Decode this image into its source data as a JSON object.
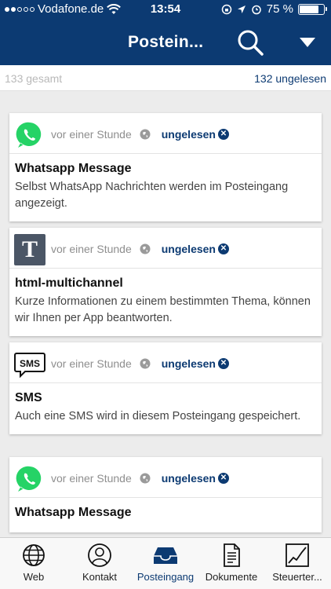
{
  "status": {
    "carrier": "Vodafone.de",
    "time": "13:54",
    "battery": "75 %"
  },
  "header": {
    "title": "Postein...",
    "search_icon": "search-icon",
    "dropdown_icon": "triangle-down-icon"
  },
  "counts": {
    "total": "133 gesamt",
    "unread": "132 ungelesen"
  },
  "messages": [
    {
      "icon": "whatsapp-icon",
      "time": "vor einer Stunde",
      "badge": "ungelesen",
      "title": "Whatsapp Message",
      "text": "Selbst WhatsApp Nachrichten werden im Posteingang angezeigt."
    },
    {
      "icon": "text-t-icon",
      "icon_letter": "T",
      "time": "vor einer Stunde",
      "badge": "ungelesen",
      "title": "html-multichannel",
      "text": "Kurze Informationen zu einem bestimmten Thema, können wir Ihnen per App beantworten."
    },
    {
      "icon": "sms-icon",
      "icon_text": "SMS",
      "time": "vor einer Stunde",
      "badge": "ungelesen",
      "title": "SMS",
      "text": "Auch eine SMS wird in diesem Posteingang gespeichert."
    },
    {
      "icon": "whatsapp-icon",
      "time": "vor einer Stunde",
      "badge": "ungelesen",
      "title": "Whatsapp Message",
      "text": ""
    }
  ],
  "tabs": [
    {
      "label": "Web",
      "icon": "globe-icon"
    },
    {
      "label": "Kontakt",
      "icon": "person-icon"
    },
    {
      "label": "Posteingang",
      "icon": "inbox-icon",
      "active": true
    },
    {
      "label": "Dokumente",
      "icon": "document-icon"
    },
    {
      "label": "Steuerter...",
      "icon": "chart-icon"
    }
  ],
  "colors": {
    "brand": "#0c3a72",
    "whatsapp": "#25d366"
  }
}
